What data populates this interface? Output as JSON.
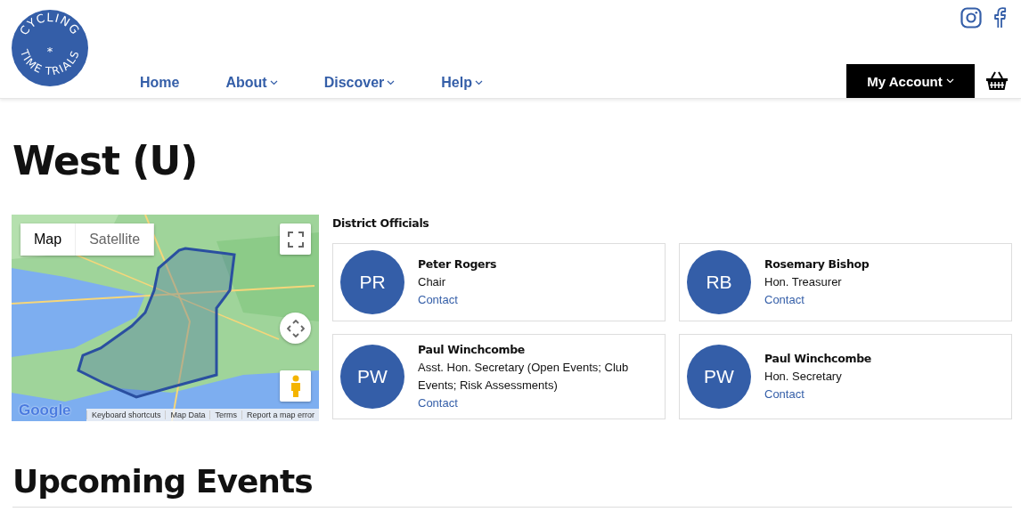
{
  "logo": {
    "top": "CYCLING",
    "star": "*",
    "bottom": "TIME TRIALS"
  },
  "nav": [
    {
      "label": "Home",
      "dropdown": false
    },
    {
      "label": "About",
      "dropdown": true
    },
    {
      "label": "Discover",
      "dropdown": true
    },
    {
      "label": "Help",
      "dropdown": true
    }
  ],
  "account": {
    "label": "My Account"
  },
  "page_title": "West (U)",
  "map": {
    "types": [
      {
        "label": "Map",
        "selected": true
      },
      {
        "label": "Satellite",
        "selected": false
      }
    ],
    "attribution_logo": "Google",
    "footer_links": [
      "Keyboard shortcuts",
      "Map Data",
      "Terms",
      "Report a map error"
    ]
  },
  "officials": {
    "heading": "District Officials",
    "people": [
      {
        "initials": "PR",
        "name": "Peter Rogers",
        "role": "Chair",
        "link": "Contact"
      },
      {
        "initials": "RB",
        "name": "Rosemary Bishop",
        "role": "Hon. Treasurer",
        "link": "Contact"
      },
      {
        "initials": "PW",
        "name": "Paul Winchcombe",
        "role": "Asst. Hon. Secretary (Open Events; Club Events; Risk Assessments)",
        "link": "Contact"
      },
      {
        "initials": "PW",
        "name": "Paul Winchcombe",
        "role": "Hon. Secretary",
        "link": "Contact"
      }
    ]
  },
  "section_title": "Upcoming Events"
}
